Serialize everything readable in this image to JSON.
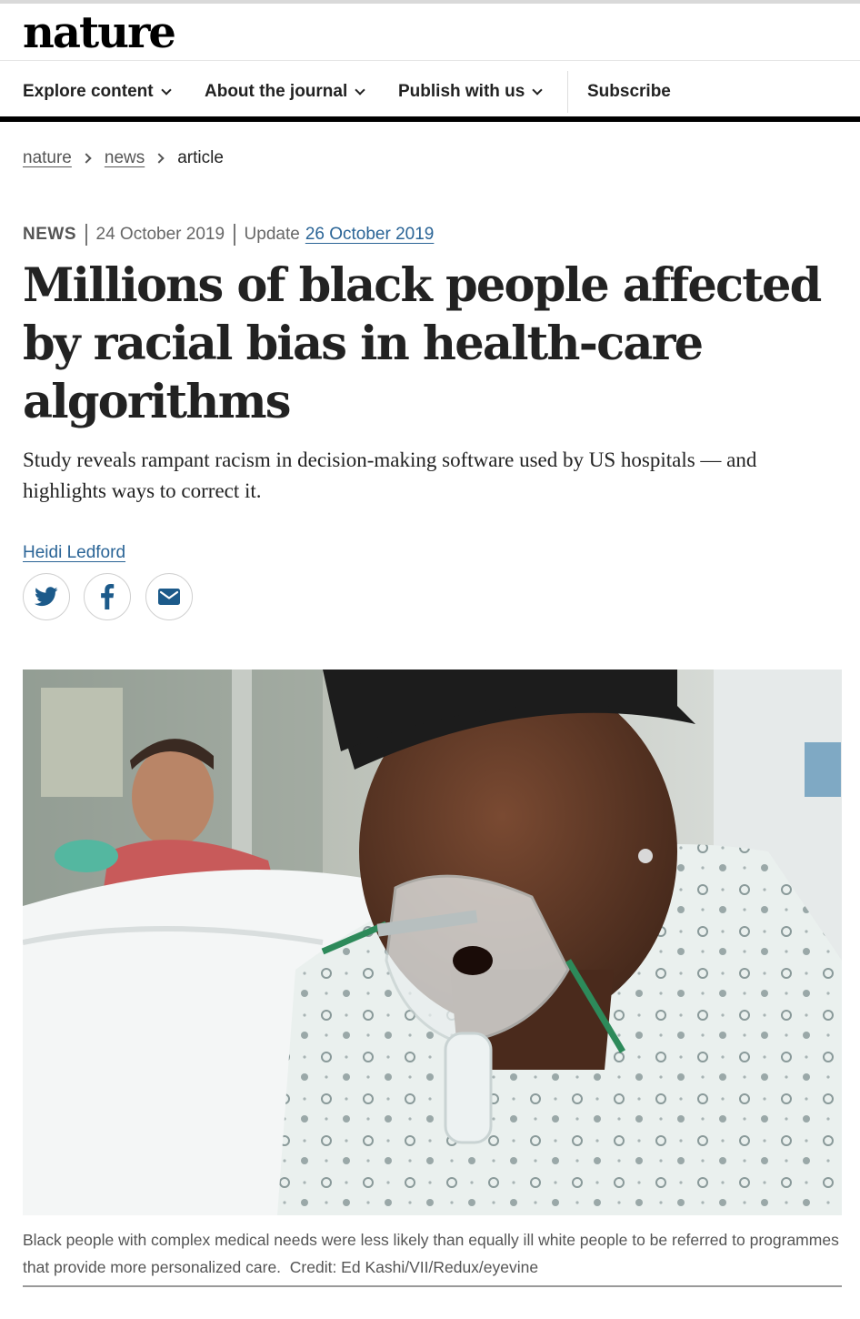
{
  "site": {
    "logo": "nature"
  },
  "nav": {
    "items": [
      {
        "label": "Explore content"
      },
      {
        "label": "About the journal"
      },
      {
        "label": "Publish with us"
      }
    ],
    "subscribe": "Subscribe"
  },
  "breadcrumb": {
    "items": [
      "nature",
      "news"
    ],
    "current": "article"
  },
  "article": {
    "type": "NEWS",
    "published": "24 October 2019",
    "update_label": "Update",
    "updated": "26 October 2019",
    "title": "Millions of black people affected by racial bias in health-care algorithms",
    "standfirst": "Study reveals rampant racism in decision-making software used by US hospitals — and highlights ways to correct it.",
    "author": "Heidi Ledford",
    "share": {
      "icons": [
        "twitter-icon",
        "facebook-icon",
        "email-icon"
      ]
    },
    "figure": {
      "caption": "Black people with complex medical needs were less likely than equally ill white people to be referred to programmes that provide more personalized care.",
      "credit": "Credit: Ed Kashi/VII/Redux/eyevine"
    }
  },
  "colors": {
    "link": "#2a6496",
    "text": "#222222",
    "muted": "#666666",
    "rule": "#000000"
  }
}
